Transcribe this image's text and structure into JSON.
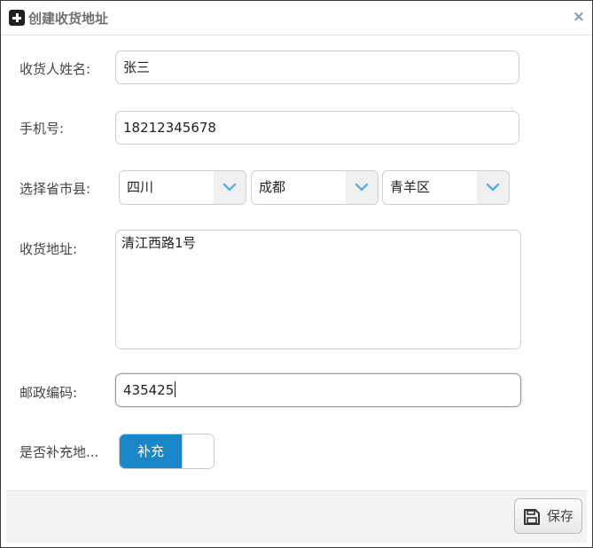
{
  "dialog": {
    "title": "创建收货地址",
    "close_glyph": "×"
  },
  "form": {
    "name": {
      "label": "收货人姓名:",
      "value": "张三"
    },
    "phone": {
      "label": "手机号:",
      "value": "18212345678"
    },
    "region": {
      "label": "选择省市县:",
      "province": "四川",
      "city": "成都",
      "district": "青羊区"
    },
    "address": {
      "label": "收货地址:",
      "value": "清江西路1号"
    },
    "postcode": {
      "label": "邮政编码:",
      "value": "435425"
    },
    "supplement": {
      "label": "是否补充地...",
      "toggle_label": "补充",
      "state": "on"
    }
  },
  "footer": {
    "save_label": "保存"
  },
  "icons": {
    "title": "plus-square-icon",
    "close": "close-icon",
    "dropdown": "chevron-down-icon",
    "save": "floppy-disk-icon"
  },
  "colors": {
    "toggle_on": "#1a87c8",
    "close": "#7a9fc3",
    "chevron": "#5aaee0"
  }
}
